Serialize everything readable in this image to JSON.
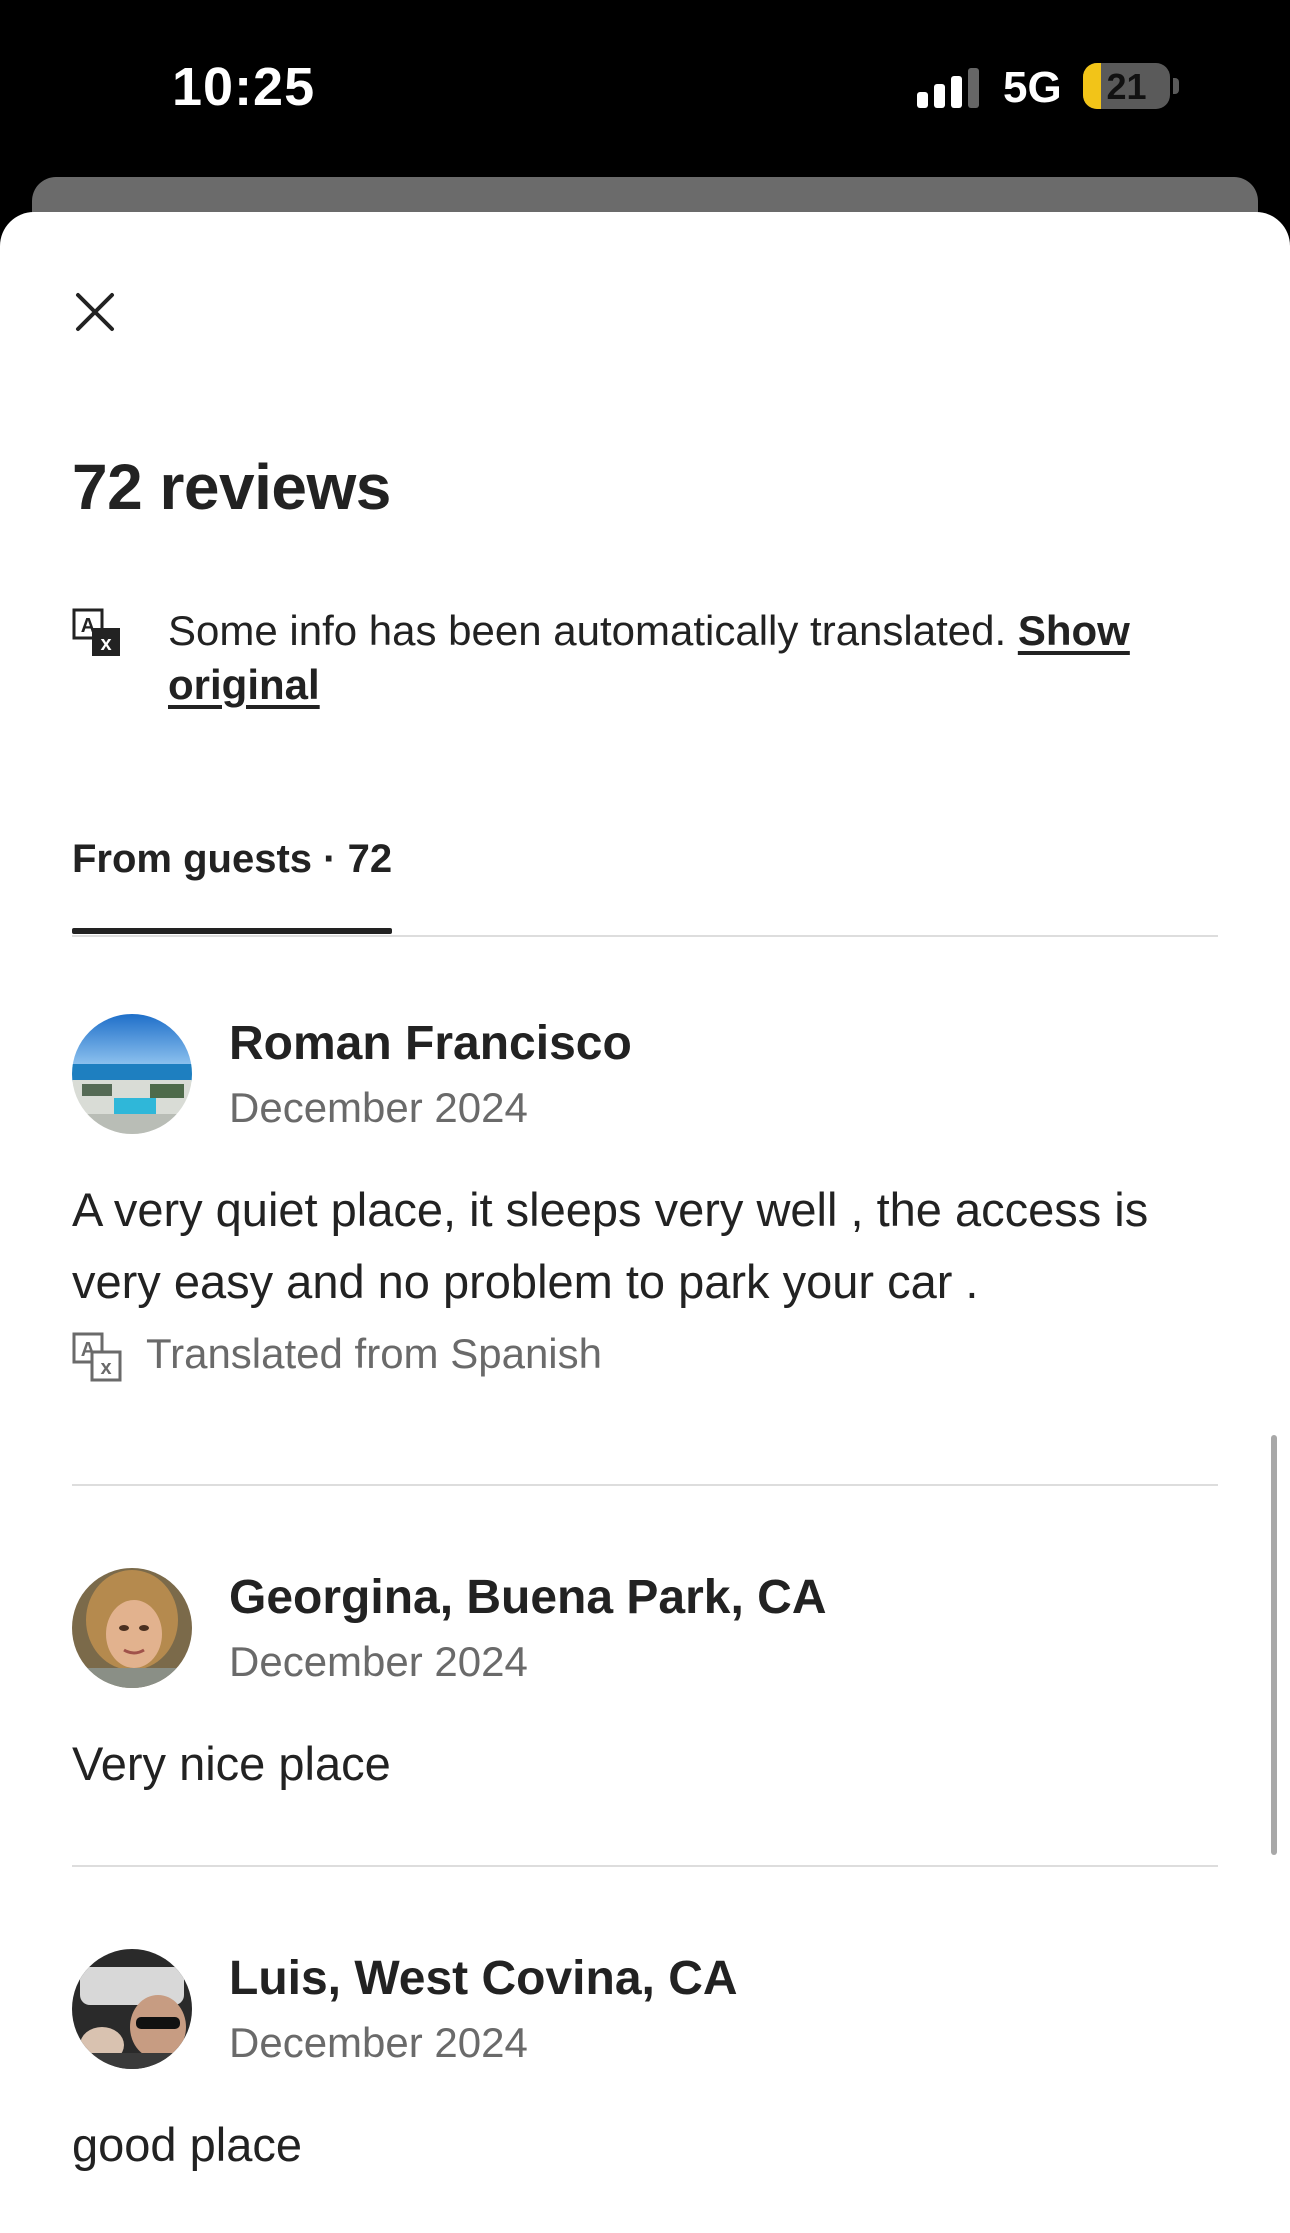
{
  "status_bar": {
    "time": "10:25",
    "network": "5G",
    "battery_level": "21",
    "battery_fraction": 0.21,
    "battery_color": "#f2c418"
  },
  "header": {
    "close_icon": "close-icon",
    "title": "72 reviews"
  },
  "translation_notice": {
    "icon": "translate-icon",
    "text": "Some info has been automatically translated. ",
    "link": "Show original"
  },
  "tabs": [
    {
      "label": "From guests · 72",
      "selected": true
    }
  ],
  "reviews": [
    {
      "name": "Roman Francisco",
      "date": "December 2024",
      "text": "A very quiet place, it sleeps very well , the access is very easy and no problem to park your car .",
      "translated_label": "Translated from Spanish",
      "avatar": "beach-resort-photo"
    },
    {
      "name": "Georgina, Buena Park, CA",
      "date": "December 2024",
      "text": "Very nice place",
      "avatar": "woman-portrait-photo"
    },
    {
      "name": "Luis, West Covina, CA",
      "date": "December 2024",
      "text": "good place",
      "avatar": "man-in-car-photo"
    }
  ]
}
